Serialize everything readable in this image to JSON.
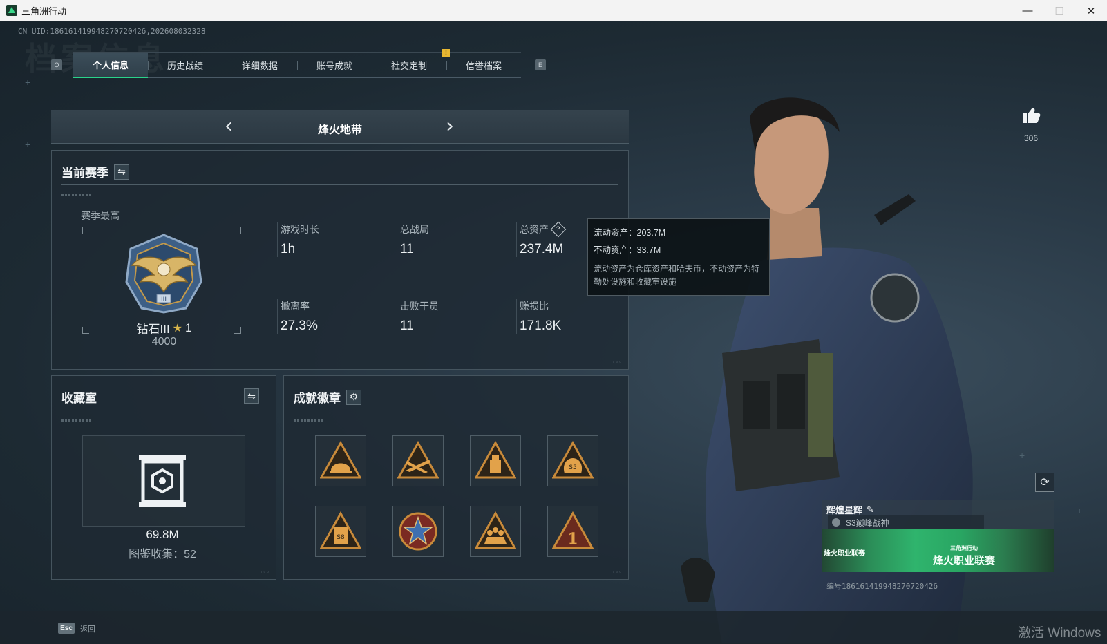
{
  "window": {
    "title": "三角洲行动",
    "minimize": "—",
    "maximize": "☐",
    "close": "✕"
  },
  "header": {
    "uid_line": "CN UID:18616141994827072042б,202608032328",
    "watermark": "档案信息"
  },
  "tabs": {
    "key_left": "Q",
    "key_right": "E",
    "notice": "!",
    "items": [
      {
        "label": "个人信息",
        "active": true
      },
      {
        "label": "历史战绩",
        "active": false
      },
      {
        "label": "详细数据",
        "active": false
      },
      {
        "label": "账号成就",
        "active": false
      },
      {
        "label": "社交定制",
        "active": false
      },
      {
        "label": "信誉档案",
        "active": false
      }
    ]
  },
  "mode": {
    "title": "烽火地带",
    "prev": "‹",
    "next": "›"
  },
  "season": {
    "title": "当前赛季",
    "swap": "⇋",
    "season_high_label": "赛季最高",
    "rank_name": "钻石III",
    "rank_star": "★",
    "rank_stars_count": "1",
    "rank_score": "4000",
    "stats": [
      {
        "label": "游戏时长",
        "value": "1h"
      },
      {
        "label": "总战局",
        "value": "11"
      },
      {
        "label": "总资产",
        "value": "237.4M",
        "help": "?"
      },
      {
        "label": "撤离率",
        "value": "27.3%"
      },
      {
        "label": "击败干员",
        "value": "11"
      },
      {
        "label": "赚损比",
        "value": "171.8K"
      }
    ],
    "dots": "▫▫▫"
  },
  "tooltip": {
    "liquid": "流动资产：203.7M",
    "fixed": "不动资产：33.7M",
    "desc": "流动资产为仓库资产和哈夫币，不动资产为特勤处设施和收藏室设施"
  },
  "collection": {
    "title": "收藏室",
    "swap": "⇋",
    "value": "69.8M",
    "count": "图鉴收集：52",
    "dots": "▫▫▫"
  },
  "badges": {
    "title": "成就徽章",
    "settings_icon": "⚙",
    "dots": "▫▫▫",
    "items": [
      {
        "icon": "helmet-badge-icon",
        "label": ""
      },
      {
        "icon": "rifle-badge-icon",
        "label": ""
      },
      {
        "icon": "usb-badge-icon",
        "label": ""
      },
      {
        "icon": "bag-badge-icon",
        "label": "S5"
      },
      {
        "icon": "card-badge-icon",
        "label": "S8"
      },
      {
        "icon": "star-medal-icon",
        "label": ""
      },
      {
        "icon": "squad-badge-icon",
        "label": ""
      },
      {
        "icon": "number-one-badge-icon",
        "label": "1"
      }
    ]
  },
  "profile": {
    "like_count": "306",
    "refresh": "⟳",
    "card_title": "辉煌星辉",
    "card_edit": "✎",
    "card_sub": "S3巅峰战神",
    "banner_left": "烽火职业联赛",
    "banner_brand": "三角洲行动",
    "banner_main": "烽火职业联赛",
    "card_id": "编号18616141994827072042б"
  },
  "footer": {
    "esc_key": "Esc",
    "esc_label": "返回",
    "activate": "激活 Windows"
  },
  "colors": {
    "accent": "#2ad28a",
    "gold": "#d9b64b",
    "badge_bronze": "#c88a3a"
  }
}
